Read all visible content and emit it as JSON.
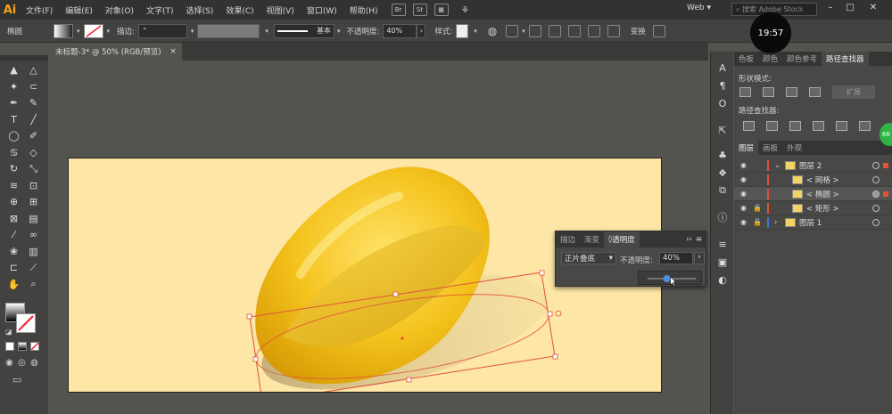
{
  "menubar": {
    "logo": "Ai",
    "items": [
      "文件(F)",
      "编辑(E)",
      "对象(O)",
      "文字(T)",
      "选择(S)",
      "效果(C)",
      "视图(V)",
      "窗口(W)",
      "帮助(H)"
    ],
    "br": "Br",
    "st": "St",
    "workspace": "Web",
    "search_placeholder": "搜索 Adobe Stock",
    "clock": "19:57",
    "win_min": "–",
    "win_max": "□"
  },
  "controlbar": {
    "object_type": "椭圆",
    "stroke_label": "描边:",
    "stroke_profile": "基本",
    "opacity_label": "不透明度:",
    "opacity_value": "40%",
    "style_label": "样式:",
    "transform_label": "变换"
  },
  "document": {
    "tab_title": "未标题-3* @ 50% (RGB/预览)",
    "close": "×"
  },
  "tools": [
    {
      "icon": "selection-icon",
      "glyph": "▲"
    },
    {
      "icon": "direct-selection-icon",
      "glyph": "△"
    },
    {
      "icon": "magic-wand-icon",
      "glyph": "✦"
    },
    {
      "icon": "lasso-icon",
      "glyph": "⊂"
    },
    {
      "icon": "pen-icon",
      "glyph": "✒"
    },
    {
      "icon": "curvature-icon",
      "glyph": "✎"
    },
    {
      "icon": "type-icon",
      "glyph": "T"
    },
    {
      "icon": "line-icon",
      "glyph": "╱"
    },
    {
      "icon": "ellipse-icon",
      "glyph": "◯"
    },
    {
      "icon": "paintbrush-icon",
      "glyph": "✐"
    },
    {
      "icon": "shaper-icon",
      "glyph": "♋"
    },
    {
      "icon": "eraser-icon",
      "glyph": "◇"
    },
    {
      "icon": "rotate-icon",
      "glyph": "↻"
    },
    {
      "icon": "scale-icon",
      "glyph": "⤡"
    },
    {
      "icon": "width-icon",
      "glyph": "≋"
    },
    {
      "icon": "free-transform-icon",
      "glyph": "⊡"
    },
    {
      "icon": "shape-builder-icon",
      "glyph": "⊕"
    },
    {
      "icon": "perspective-icon",
      "glyph": "⊞"
    },
    {
      "icon": "mesh-icon",
      "glyph": "⊠"
    },
    {
      "icon": "gradient-icon",
      "glyph": "▤"
    },
    {
      "icon": "eyedropper-icon",
      "glyph": "⁄"
    },
    {
      "icon": "blend-icon",
      "glyph": "∞"
    },
    {
      "icon": "symbol-sprayer-icon",
      "glyph": "❀"
    },
    {
      "icon": "column-graph-icon",
      "glyph": "▥"
    },
    {
      "icon": "artboard-icon",
      "glyph": "⊏"
    },
    {
      "icon": "slice-icon",
      "glyph": "⟋"
    },
    {
      "icon": "hand-icon",
      "glyph": "✋"
    },
    {
      "icon": "zoom-icon",
      "glyph": "⌕"
    }
  ],
  "strip_icons": [
    {
      "icon": "character-icon",
      "glyph": "A"
    },
    {
      "icon": "paragraph-icon",
      "glyph": "¶"
    },
    {
      "icon": "opentype-icon",
      "glyph": "O"
    },
    {
      "icon": "export-icon",
      "glyph": "⇱"
    },
    {
      "icon": "symbols-icon",
      "glyph": "♣"
    },
    {
      "icon": "graphic-styles-icon",
      "glyph": "❖"
    },
    {
      "icon": "asset-export-icon",
      "glyph": "⧉"
    },
    {
      "icon": "info-icon",
      "glyph": "ⓘ"
    },
    {
      "icon": "align-icon",
      "glyph": "≡"
    },
    {
      "icon": "appearance-icon",
      "glyph": "▣"
    },
    {
      "icon": "transparency-icon",
      "glyph": "◐"
    }
  ],
  "pathfinder": {
    "tabs": [
      "色板",
      "颜色",
      "颜色参考",
      "路径查找器"
    ],
    "shape_modes": "形状模式:",
    "pathfinders": "路径查找器:",
    "expand": "扩展"
  },
  "layers": {
    "tabs": [
      "图层",
      "画板",
      "外观"
    ],
    "rows": [
      {
        "name": "图层 2",
        "color": "#e0523a"
      },
      {
        "name": "< 网格 >",
        "color": "#e0523a"
      },
      {
        "name": "< 椭圆 >",
        "color": "#e0523a"
      },
      {
        "name": "< 矩形 >",
        "color": "#e0523a"
      },
      {
        "name": "图层 1",
        "color": "#4a6fd8"
      }
    ]
  },
  "transparency_panel": {
    "tabs": [
      "描边",
      "渐变",
      "透明度"
    ],
    "blend_mode": "正片叠底",
    "opacity_label": "不透明度:",
    "opacity_value": "40%",
    "menu_glyph": "››",
    "slider_value": 0.4
  },
  "badge": "66"
}
